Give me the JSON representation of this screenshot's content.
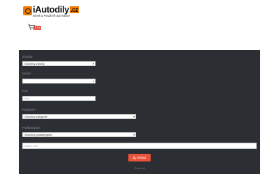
{
  "header": {
    "logo_name": "iAutodily",
    "logo_tld": ".cz",
    "logo_tagline": "NOVÉ A POUŽITÉ AUTODÍLY",
    "cart_icon": "cart-icon",
    "cart_count": "0 Kč"
  },
  "filters": {
    "brand": {
      "label": "Značka",
      "value": "Všechny značky"
    },
    "model": {
      "label": "Model",
      "value": ""
    },
    "year": {
      "label": "Rok",
      "placeholder": "Rok"
    },
    "category": {
      "label": "Kategorie",
      "value": "Všechny kategorie"
    },
    "subcategory": {
      "label": "Podkategorie",
      "value": "Všechny podkategorie"
    },
    "search": {
      "placeholder": "Název dílu"
    },
    "submit_icon": "search-icon",
    "submit_label": "Hledat",
    "reset_label": "Reset all"
  },
  "colors": {
    "panel": "#2b2e33",
    "accent": "#e8533a",
    "brand": "#f07c00"
  }
}
